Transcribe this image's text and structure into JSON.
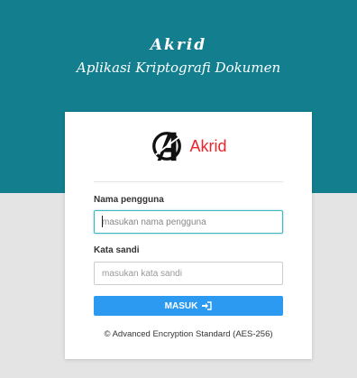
{
  "header": {
    "title": "Akrid",
    "subtitle": "Aplikasi Kriptografi Dokumen"
  },
  "login": {
    "brand_name": "Akrid",
    "username_label": "Nama pengguna",
    "username_placeholder": "masukan nama pengguna",
    "username_value": "",
    "password_label": "Kata sandi",
    "password_placeholder": "masukan kata sandi",
    "password_value": "",
    "submit_label": "MASUK",
    "submit_icon": "sign-in-icon",
    "footer": "© Advanced Encryption Standard (AES-256)"
  },
  "colors": {
    "header_bg": "#137f8e",
    "page_bg": "#e4e4e4",
    "brand_red": "#e8262b",
    "button_blue": "#2c9af0",
    "focus_border": "#3fb7c0"
  }
}
